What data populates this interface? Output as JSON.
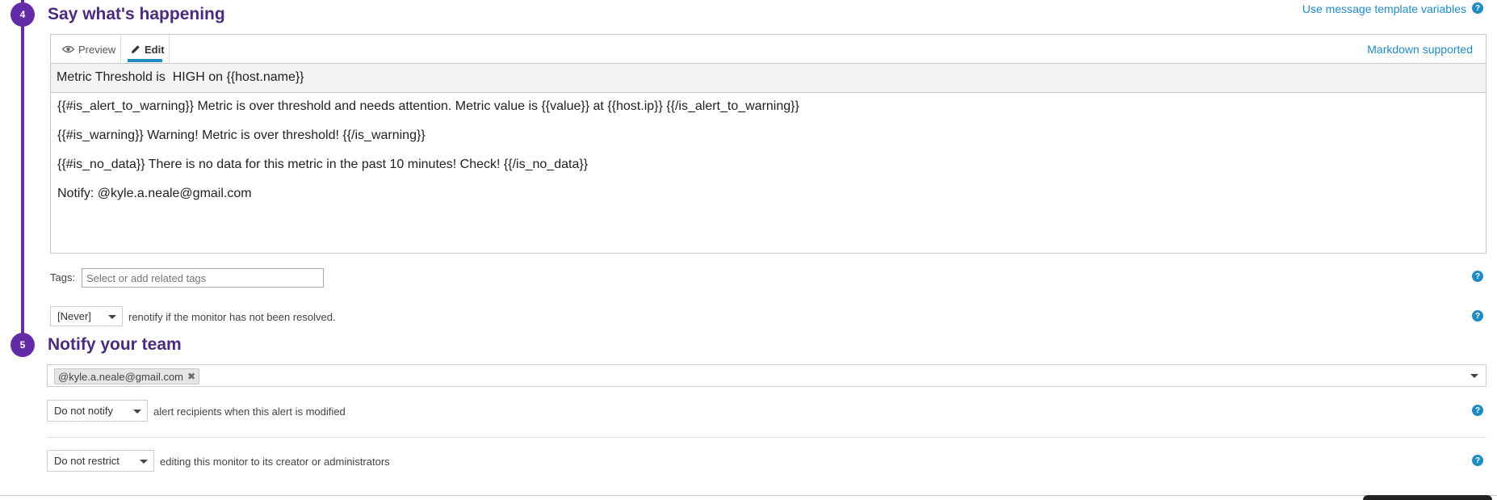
{
  "step4": {
    "number": "4",
    "title": "Say what's happening",
    "template_link": "Use message template variables",
    "tabs": {
      "preview": "Preview",
      "edit": "Edit"
    },
    "markdown": "Markdown supported",
    "subject": "Metric Threshold is  HIGH on {{host.name}}",
    "body": [
      "{{#is_alert_to_warning}} Metric is over threshold and needs attention. Metric value is {{value}} at {{host.ip}} {{/is_alert_to_warning}}",
      "{{#is_warning}} Warning! Metric is over threshold! {{/is_warning}}",
      "{{#is_no_data}} There is no data for this metric in the past 10 minutes! Check! {{/is_no_data}}",
      "Notify: @kyle.a.neale@gmail.com"
    ],
    "tags_label": "Tags:",
    "tags_placeholder": "Select or add related tags",
    "renotify_value": "[Never]",
    "renotify_text": "renotify if the monitor has not been resolved."
  },
  "step5": {
    "number": "5",
    "title": "Notify your team",
    "recipient_token": "@kyle.a.neale@gmail.com",
    "notify_value": "Do not notify",
    "notify_text": "alert recipients when this alert is modified",
    "restrict_value": "Do not restrict",
    "restrict_text": "editing this monitor to its creator or administrators"
  },
  "help_glyph": "?",
  "remove_glyph": "✖",
  "colors": {
    "accent_purple": "#632ca6",
    "link_blue": "#1f8bc4",
    "tab_underline": "#1f8bc4"
  },
  "icons": [
    "eye-icon",
    "pencil-icon",
    "help-icon",
    "close-icon",
    "caret-down-icon"
  ]
}
